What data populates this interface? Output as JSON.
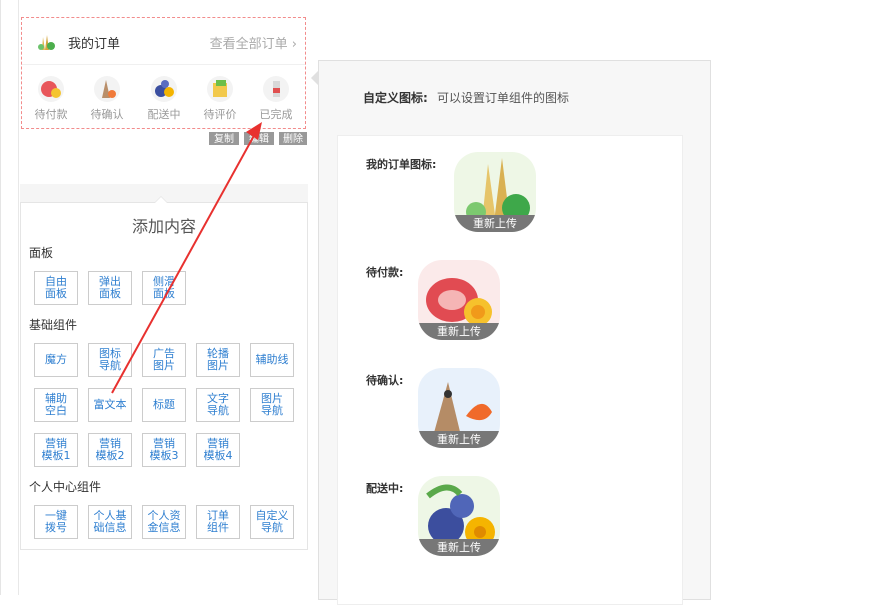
{
  "order": {
    "title": "我的订单",
    "view_all": "查看全部订单 ›",
    "statuses": [
      {
        "label": "待付款",
        "icon": "meat-egg-icon"
      },
      {
        "label": "待确认",
        "icon": "fish-shrimp-icon"
      },
      {
        "label": "配送中",
        "icon": "blueberry-flower-icon"
      },
      {
        "label": "待评价",
        "icon": "package-icon"
      },
      {
        "label": "已完成",
        "icon": "bottle-icon"
      }
    ],
    "ops": {
      "copy": "复制",
      "edit": "编辑",
      "delete": "删除"
    }
  },
  "add_content": {
    "title": "添加内容",
    "sections": [
      {
        "name": "面板",
        "items": [
          "自由\n面板",
          "弹出\n面板",
          "侧滑\n面板"
        ]
      },
      {
        "name": "基础组件",
        "items": [
          "魔方",
          "图标\n导航",
          "广告\n图片",
          "轮播\n图片",
          "辅助线",
          "辅助\n空白",
          "富文本",
          "标题",
          "文字\n导航",
          "图片\n导航",
          "营销\n模板1",
          "营销\n模板2",
          "营销\n模板3",
          "营销\n模板4"
        ]
      },
      {
        "name": "个人中心组件",
        "items": [
          "一键\n拨号",
          "个人基\n础信息",
          "个人资\n金信息",
          "订单\n组件",
          "自定义\n导航"
        ]
      }
    ]
  },
  "config": {
    "label": "自定义图标:",
    "desc": "可以设置订单组件的图标",
    "rows": [
      {
        "label": "我的订单图标:",
        "button": "重新上传",
        "icon": "bamboo-vegetables-icon"
      },
      {
        "label": "待付款:",
        "button": "重新上传",
        "icon": "meat-egg-icon"
      },
      {
        "label": "待确认:",
        "button": "重新上传",
        "icon": "fish-shrimp-icon"
      },
      {
        "label": "配送中:",
        "button": "重新上传",
        "icon": "blueberry-flower-icon"
      }
    ]
  },
  "colors": {
    "accent": "#2f7fd0",
    "dashed_border": "#f28c8c",
    "arrow": "#e8312f"
  }
}
